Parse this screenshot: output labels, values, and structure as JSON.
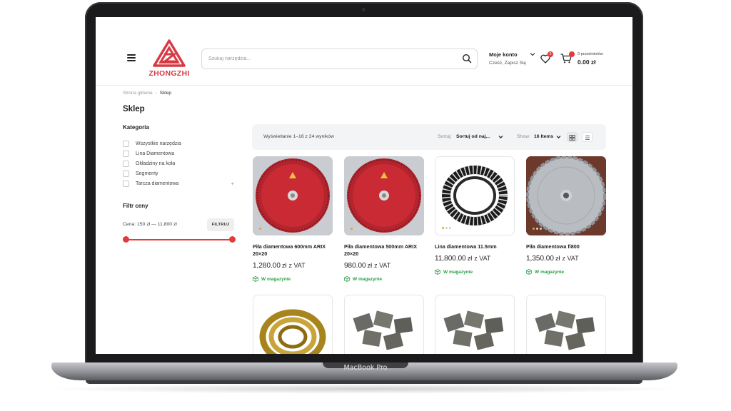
{
  "device": {
    "label": "MacBook Pro"
  },
  "header": {
    "logo_text": "ZHONGZHI",
    "search": {
      "placeholder": "Szukaj narzędzia..."
    },
    "account": {
      "title": "Moje konto",
      "subtitle": "Cześć, Zapisz Się"
    },
    "wishlist": {
      "count": "0"
    },
    "cart": {
      "items_label": "0 przedmiotów",
      "total": "0.00 zł"
    }
  },
  "breadcrumb": {
    "home": "Strona główna",
    "current": "Sklep"
  },
  "page_title": "Sklep",
  "sidebar": {
    "category_heading": "Kategoria",
    "categories": [
      {
        "label": "Wszystkie narzędzia"
      },
      {
        "label": "Lina Diamentowa"
      },
      {
        "label": "Okładziny na koła"
      },
      {
        "label": "Segmenty"
      },
      {
        "label": "Tarcza diamentowa",
        "expand": "+"
      }
    ],
    "price_heading": "Filtr ceny",
    "price_range": "Cena: 150 zł — 11,800 zł",
    "filter_button": "FILTRUJ"
  },
  "toolbar": {
    "showing": "Wyświetlanie 1–16 z 24 wyników",
    "sort_label": "Sortuj:",
    "sort_value": "Sortuj od naj...",
    "show_label": "Show:",
    "show_value": "16 Items"
  },
  "products": [
    {
      "name": "Piła diamentowa 600mm ARIX 20×20",
      "price": "1,280.00",
      "currency": "zł",
      "vat": "z VAT",
      "stock": "W magazynie"
    },
    {
      "name": "Piła diamentowa 500mm ARIX 20×20",
      "price": "980.00",
      "currency": "zł",
      "vat": "z VAT",
      "stock": "W magazynie"
    },
    {
      "name": "Lina diamentowa 11.5mm",
      "price": "11,800.00",
      "currency": "zł",
      "vat": "z VAT",
      "stock": "W magazynie"
    },
    {
      "name": "Piła diamentowa fi800",
      "price": "1,350.00",
      "currency": "zł",
      "vat": "z VAT",
      "stock": "W magazynie"
    }
  ],
  "colors": {
    "brand_red": "#d83a45",
    "accent_red": "#e53a3a",
    "stock_green": "#2aa048"
  }
}
